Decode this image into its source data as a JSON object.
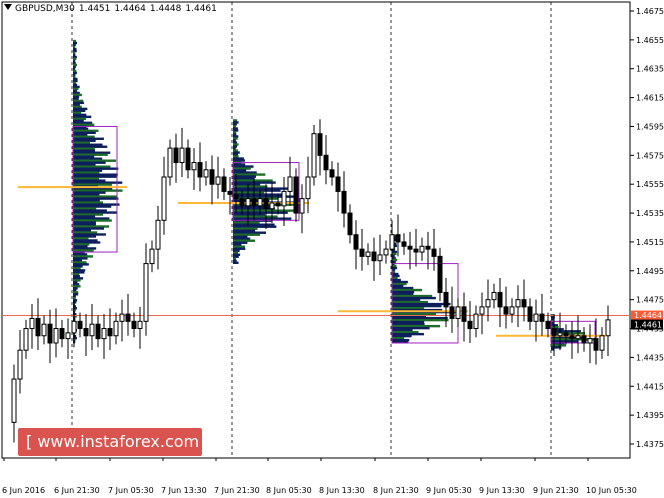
{
  "header": {
    "symbol": "GBPUSD,M30",
    "ohlc": [
      "1.4451",
      "1.4464",
      "1.4448",
      "1.4461"
    ]
  },
  "badge": {
    "text": "[ www.instaforex.com ]"
  },
  "colors": {
    "candle": "#000000",
    "profile_dark": "#0d1f5c",
    "profile_green": "#1f6b2a",
    "value_area_box": "#a020c0",
    "poc_line": "#ffb833",
    "price_line": "#e86a50",
    "price_label_bg": "#ff5a36",
    "current_label_bg": "#000000",
    "badge_bg": "#d9534f"
  },
  "chart_data": {
    "type": "candlestick",
    "title": "GBPUSD,M30",
    "ylim": [
      1.4375,
      1.4675
    ],
    "y_ticks": [
      "1.4675",
      "1.4655",
      "1.4635",
      "1.4615",
      "1.4595",
      "1.4575",
      "1.4555",
      "1.4535",
      "1.4515",
      "1.4495",
      "1.4475",
      "1.4455",
      "1.4435",
      "1.4415",
      "1.4395",
      "1.4375"
    ],
    "x_ticks": [
      "6 Jun 2016",
      "6 Jun 21:30",
      "7 Jun 05:30",
      "7 Jun 13:30",
      "7 Jun 21:30",
      "8 Jun 05:30",
      "8 Jun 13:30",
      "8 Jun 21:30",
      "9 Jun 05:30",
      "9 Jun 13:30",
      "9 Jun 21:30",
      "10 Jun 05:30"
    ],
    "session_separators": [
      "6 Jun 21:30",
      "7 Jun 21:30",
      "8 Jun 21:30",
      "9 Jun 21:30"
    ],
    "current_price": "1.4461",
    "line_price_label": "1.4464",
    "line_price": 1.4464,
    "price_path": [
      {
        "x": 0,
        "y": 1.439
      },
      {
        "x": 1,
        "y": 1.442
      },
      {
        "x": 2,
        "y": 1.444
      },
      {
        "x": 3,
        "y": 1.4455
      },
      {
        "x": 4,
        "y": 1.4462
      },
      {
        "x": 5,
        "y": 1.445
      },
      {
        "x": 6,
        "y": 1.4458
      },
      {
        "x": 7,
        "y": 1.4445
      },
      {
        "x": 8,
        "y": 1.4455
      },
      {
        "x": 9,
        "y": 1.4448
      },
      {
        "x": 10,
        "y": 1.4452
      },
      {
        "x": 11,
        "y": 1.446
      },
      {
        "x": 12,
        "y": 1.4455
      },
      {
        "x": 13,
        "y": 1.445
      },
      {
        "x": 14,
        "y": 1.4458
      },
      {
        "x": 15,
        "y": 1.4448
      },
      {
        "x": 16,
        "y": 1.4455
      },
      {
        "x": 17,
        "y": 1.445
      },
      {
        "x": 18,
        "y": 1.446
      },
      {
        "x": 19,
        "y": 1.4465
      },
      {
        "x": 20,
        "y": 1.446
      },
      {
        "x": 21,
        "y": 1.4455
      },
      {
        "x": 22,
        "y": 1.446
      },
      {
        "x": 23,
        "y": 1.45
      },
      {
        "x": 24,
        "y": 1.451
      },
      {
        "x": 25,
        "y": 1.453
      },
      {
        "x": 26,
        "y": 1.456
      },
      {
        "x": 27,
        "y": 1.458
      },
      {
        "x": 28,
        "y": 1.457
      },
      {
        "x": 29,
        "y": 1.458
      },
      {
        "x": 30,
        "y": 1.4565
      },
      {
        "x": 31,
        "y": 1.457
      },
      {
        "x": 32,
        "y": 1.456
      },
      {
        "x": 33,
        "y": 1.4565
      },
      {
        "x": 34,
        "y": 1.4555
      },
      {
        "x": 35,
        "y": 1.456
      },
      {
        "x": 36,
        "y": 1.455
      },
      {
        "x": 37,
        "y": 1.4548
      },
      {
        "x": 38,
        "y": 1.4545
      },
      {
        "x": 39,
        "y": 1.454
      },
      {
        "x": 40,
        "y": 1.4545
      },
      {
        "x": 41,
        "y": 1.454
      },
      {
        "x": 42,
        "y": 1.4545
      },
      {
        "x": 43,
        "y": 1.4538
      },
      {
        "x": 44,
        "y": 1.4542
      },
      {
        "x": 45,
        "y": 1.454
      },
      {
        "x": 46,
        "y": 1.455
      },
      {
        "x": 47,
        "y": 1.456
      },
      {
        "x": 48,
        "y": 1.4535
      },
      {
        "x": 49,
        "y": 1.4545
      },
      {
        "x": 50,
        "y": 1.456
      },
      {
        "x": 51,
        "y": 1.459
      },
      {
        "x": 52,
        "y": 1.4575
      },
      {
        "x": 53,
        "y": 1.4565
      },
      {
        "x": 54,
        "y": 1.456
      },
      {
        "x": 55,
        "y": 1.455
      },
      {
        "x": 56,
        "y": 1.4535
      },
      {
        "x": 57,
        "y": 1.452
      },
      {
        "x": 58,
        "y": 1.451
      },
      {
        "x": 59,
        "y": 1.4505
      },
      {
        "x": 60,
        "y": 1.4508
      },
      {
        "x": 61,
        "y": 1.4502
      },
      {
        "x": 62,
        "y": 1.4506
      },
      {
        "x": 63,
        "y": 1.451
      },
      {
        "x": 64,
        "y": 1.452
      },
      {
        "x": 65,
        "y": 1.4515
      },
      {
        "x": 66,
        "y": 1.4512
      },
      {
        "x": 67,
        "y": 1.451
      },
      {
        "x": 68,
        "y": 1.4508
      },
      {
        "x": 69,
        "y": 1.4512
      },
      {
        "x": 70,
        "y": 1.451
      },
      {
        "x": 71,
        "y": 1.4505
      },
      {
        "x": 72,
        "y": 1.448
      },
      {
        "x": 73,
        "y": 1.447
      },
      {
        "x": 74,
        "y": 1.4462
      },
      {
        "x": 75,
        "y": 1.447
      },
      {
        "x": 76,
        "y": 1.446
      },
      {
        "x": 77,
        "y": 1.4455
      },
      {
        "x": 78,
        "y": 1.4465
      },
      {
        "x": 79,
        "y": 1.447
      },
      {
        "x": 80,
        "y": 1.4475
      },
      {
        "x": 81,
        "y": 1.448
      },
      {
        "x": 82,
        "y": 1.447
      },
      {
        "x": 83,
        "y": 1.4465
      },
      {
        "x": 84,
        "y": 1.447
      },
      {
        "x": 85,
        "y": 1.4475
      },
      {
        "x": 86,
        "y": 1.447
      },
      {
        "x": 87,
        "y": 1.446
      },
      {
        "x": 88,
        "y": 1.4465
      },
      {
        "x": 89,
        "y": 1.446
      },
      {
        "x": 90,
        "y": 1.4455
      },
      {
        "x": 91,
        "y": 1.445
      },
      {
        "x": 92,
        "y": 1.4452
      },
      {
        "x": 93,
        "y": 1.445
      },
      {
        "x": 94,
        "y": 1.4448
      },
      {
        "x": 95,
        "y": 1.445
      },
      {
        "x": 96,
        "y": 1.4445
      },
      {
        "x": 97,
        "y": 1.4448
      },
      {
        "x": 98,
        "y": 1.444
      },
      {
        "x": 99,
        "y": 1.445
      },
      {
        "x": 100,
        "y": 1.4461
      }
    ],
    "market_profiles": [
      {
        "session": "6 Jun",
        "poc": 1.4553,
        "va_high": 1.4595,
        "va_low": 1.4508,
        "range": [
          1.4445,
          1.4655
        ]
      },
      {
        "session": "7 Jun",
        "poc": 1.4542,
        "va_high": 1.457,
        "va_low": 1.453,
        "range": [
          1.45,
          1.46
        ]
      },
      {
        "session": "8 Jun",
        "poc": 1.4467,
        "va_high": 1.45,
        "va_low": 1.4445,
        "range": [
          1.4445,
          1.452
        ]
      },
      {
        "session": "9 Jun",
        "poc": 1.445,
        "va_high": 1.446,
        "va_low": 1.4445,
        "range": [
          1.444,
          1.4465
        ]
      }
    ]
  }
}
